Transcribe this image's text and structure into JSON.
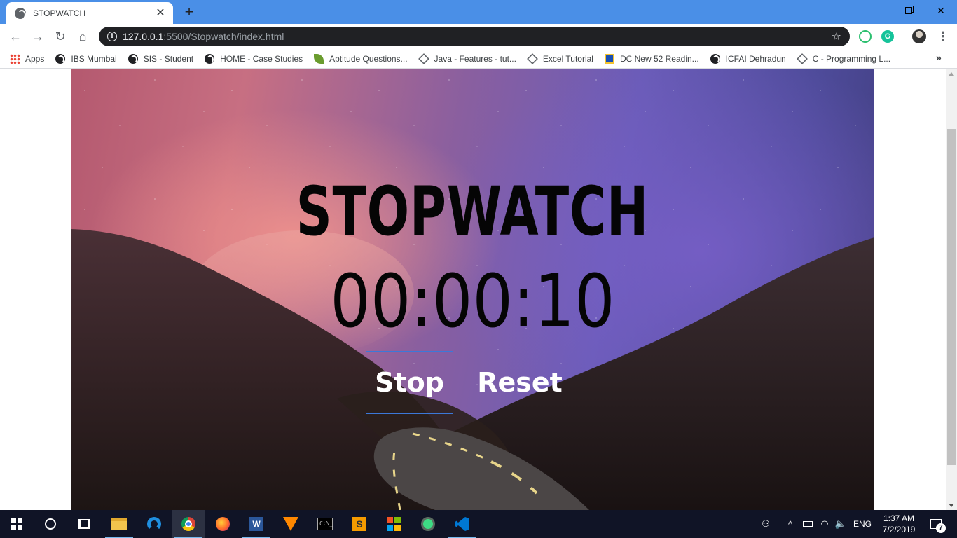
{
  "browser": {
    "tab": {
      "title": "STOPWATCH",
      "close_glyph": "✕",
      "icon": "globe-icon"
    },
    "new_tab_glyph": "+",
    "window_controls": {
      "minimize": "minimize-icon",
      "maximize": "restore-icon",
      "close_glyph": "✕"
    },
    "nav": {
      "back_glyph": "←",
      "forward_glyph": "→",
      "reload_glyph": "↻",
      "home_glyph": "⌂"
    },
    "address": {
      "host": "127.0.0.1",
      "path": ":5500/Stopwatch/index.html",
      "star_glyph": "☆",
      "info_glyph": "i"
    },
    "extensions": [
      "grammarly-circle-icon",
      "grammarly-g-icon"
    ],
    "extension_2_glyph": "G",
    "menu_glyph": "⋮",
    "bookmarks": [
      {
        "label": "Apps",
        "icon": "apps-grid-icon"
      },
      {
        "label": "IBS Mumbai",
        "icon": "globe-icon"
      },
      {
        "label": "SIS - Student",
        "icon": "globe-icon"
      },
      {
        "label": "HOME - Case Studies",
        "icon": "globe-icon"
      },
      {
        "label": "Aptitude Questions...",
        "icon": "leaf-icon"
      },
      {
        "label": "Java - Features - tut...",
        "icon": "diamond-icon"
      },
      {
        "label": "Excel Tutorial",
        "icon": "diamond-icon"
      },
      {
        "label": "DC New 52 Readin...",
        "icon": "dc-badge-icon"
      },
      {
        "label": "ICFAI Dehradun",
        "icon": "globe-icon"
      },
      {
        "label": "C - Programming L...",
        "icon": "diamond-icon"
      }
    ],
    "bookmarks_more_glyph": "»"
  },
  "page": {
    "title": "STOPWATCH",
    "timer": "00:00:10",
    "buttons": {
      "stop": "Stop",
      "reset": "Reset"
    }
  },
  "taskbar": {
    "apps": [
      "windows-start",
      "cortana-search",
      "task-view",
      "file-explorer",
      "edge",
      "chrome",
      "firefox",
      "word",
      "vlc",
      "command-prompt",
      "sublime-text",
      "windows-apps",
      "android-studio",
      "vscode"
    ],
    "word_glyph": "W",
    "cmd_glyph": "C:\\_",
    "sublime_glyph": "S",
    "tray": {
      "people_glyph": "⚇",
      "chevron_glyph": "^",
      "wifi_glyph": "◠",
      "volume_glyph": "🔈",
      "language": "ENG",
      "time": "1:37 AM",
      "date": "7/2/2019",
      "notification_count": "7"
    }
  },
  "colors": {
    "tab_strip": "#4a8fe7",
    "omnibox": "#202124",
    "taskbar": "#101426",
    "stop_button_border": "#3c78d8",
    "heading_text": "#050505",
    "button_text": "#ffffff"
  }
}
